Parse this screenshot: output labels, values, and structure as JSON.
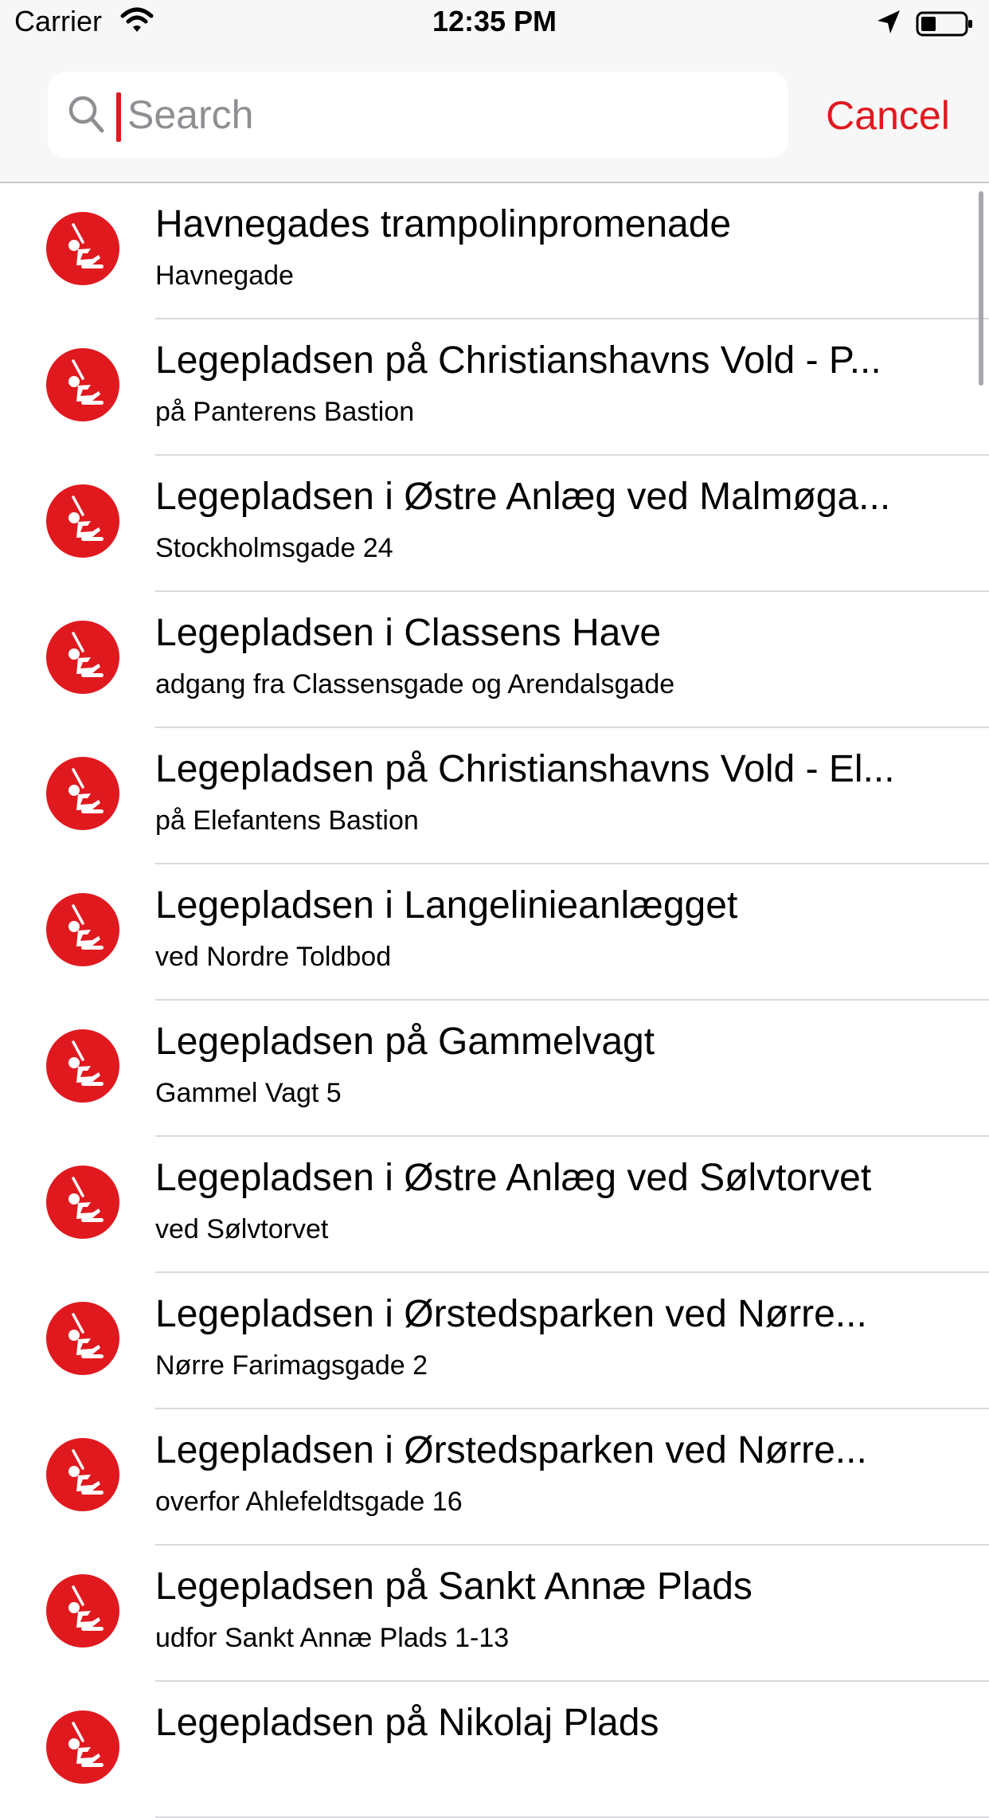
{
  "status_bar": {
    "carrier": "Carrier",
    "time": "12:35 PM"
  },
  "search": {
    "placeholder": "Search",
    "value": "",
    "cancel_label": "Cancel"
  },
  "colors": {
    "accent": "#e0191f",
    "separator": "#d9d9de",
    "header_bg": "#f7f7f7"
  },
  "list_icon": "playground-swing-icon",
  "items": [
    {
      "title": "Havnegades trampolinpromenade",
      "subtitle": "Havnegade"
    },
    {
      "title": "Legepladsen på Christianshavns Vold - P...",
      "subtitle": "på Panterens Bastion"
    },
    {
      "title": "Legepladsen i Østre Anlæg ved Malmøga...",
      "subtitle": "Stockholmsgade 24"
    },
    {
      "title": "Legepladsen i Classens Have",
      "subtitle": "adgang fra Classensgade og Arendalsgade"
    },
    {
      "title": "Legepladsen på Christianshavns Vold - El...",
      "subtitle": "på Elefantens Bastion"
    },
    {
      "title": "Legepladsen i Langelinieanlægget",
      "subtitle": "ved Nordre Toldbod"
    },
    {
      "title": "Legepladsen på Gammelvagt",
      "subtitle": "Gammel Vagt 5"
    },
    {
      "title": "Legepladsen i Østre Anlæg ved Sølvtorvet",
      "subtitle": "ved Sølvtorvet"
    },
    {
      "title": "Legepladsen i Ørstedsparken ved Nørre...",
      "subtitle": "Nørre Farimagsgade 2"
    },
    {
      "title": "Legepladsen i Ørstedsparken ved Nørre...",
      "subtitle": "overfor Ahlefeldtsgade 16"
    },
    {
      "title": "Legepladsen på Sankt Annæ Plads",
      "subtitle": "udfor Sankt Annæ Plads 1-13"
    },
    {
      "title": "Legepladsen på Nikolaj Plads",
      "subtitle": ""
    }
  ]
}
